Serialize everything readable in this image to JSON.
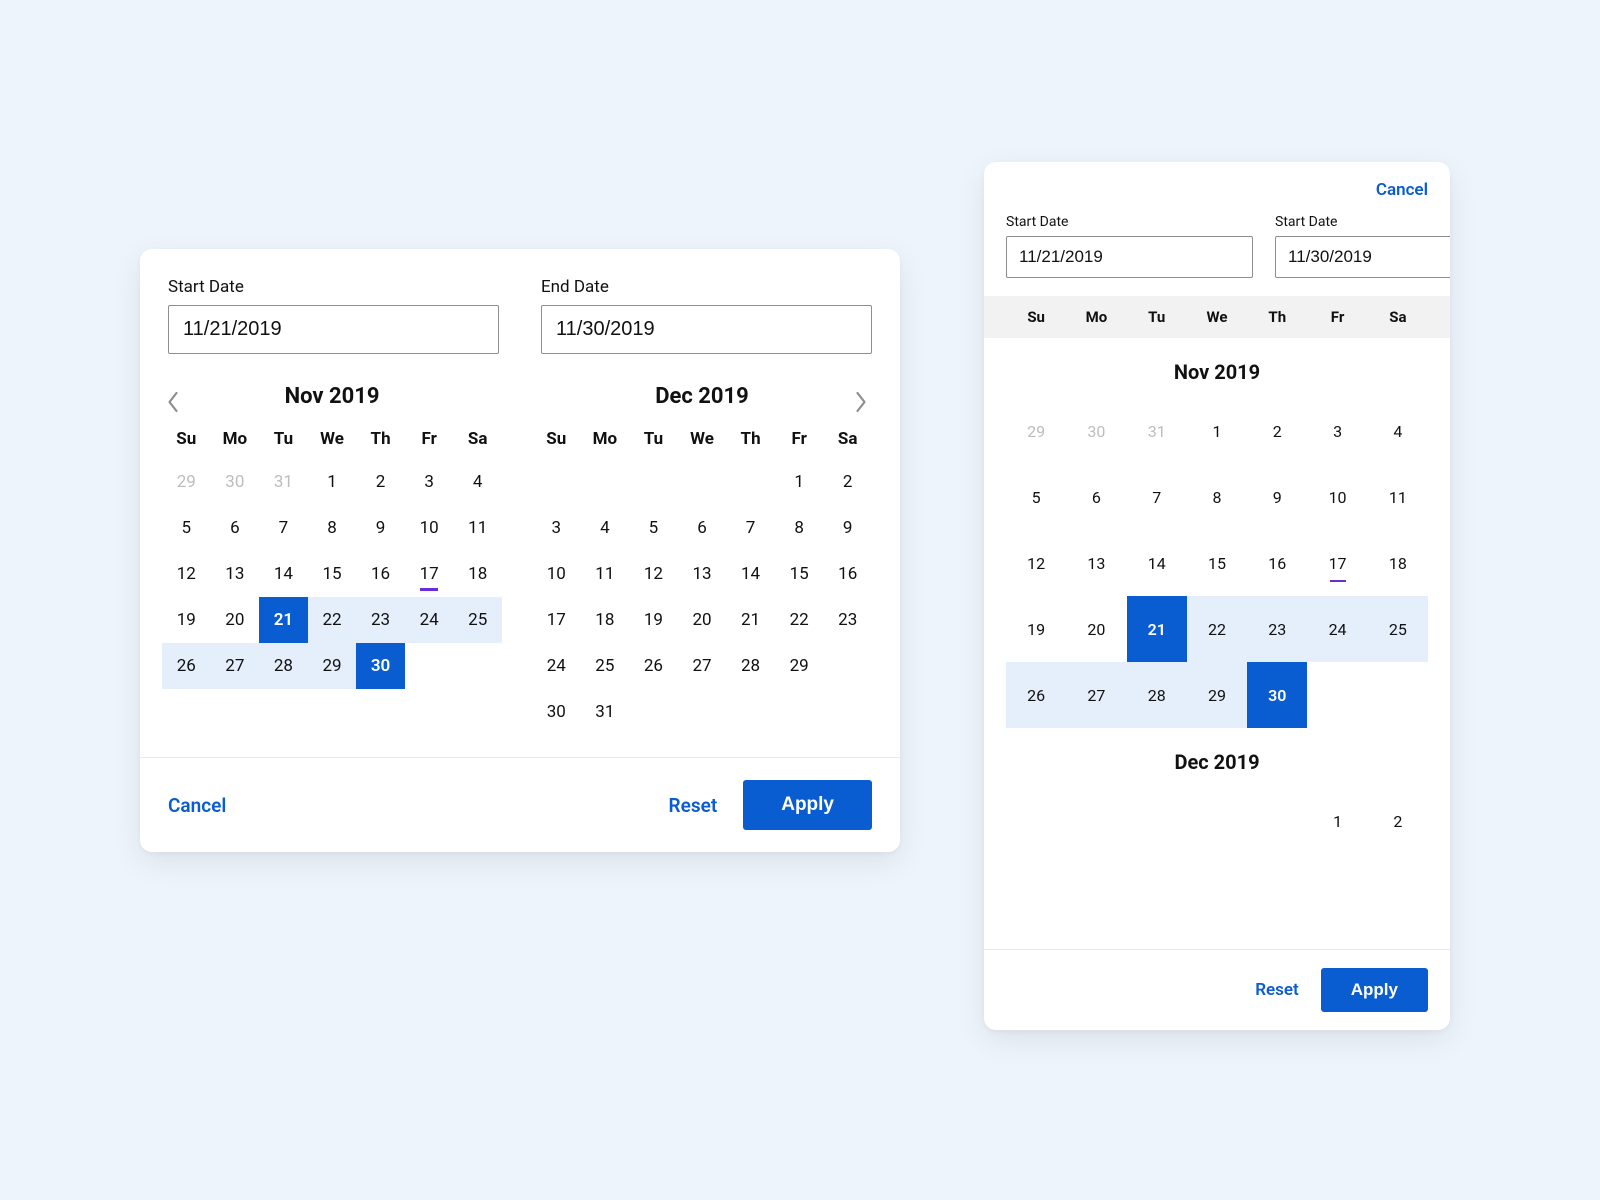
{
  "labels": {
    "startDate": "Start Date",
    "endDate": "End Date",
    "cancel": "Cancel",
    "reset": "Reset",
    "apply": "Apply"
  },
  "values": {
    "startDate": "11/21/2019",
    "endDate": "11/30/2019"
  },
  "dow": [
    "Su",
    "Mo",
    "Tu",
    "We",
    "Th",
    "Fr",
    "Sa"
  ],
  "desktop": {
    "months": [
      {
        "title": "Nov 2019",
        "weeks": [
          [
            {
              "n": "29",
              "muted": true
            },
            {
              "n": "30",
              "muted": true
            },
            {
              "n": "31",
              "muted": true
            },
            {
              "n": "1"
            },
            {
              "n": "2"
            },
            {
              "n": "3"
            },
            {
              "n": "4"
            }
          ],
          [
            {
              "n": "5"
            },
            {
              "n": "6"
            },
            {
              "n": "7"
            },
            {
              "n": "8"
            },
            {
              "n": "9"
            },
            {
              "n": "10"
            },
            {
              "n": "11"
            }
          ],
          [
            {
              "n": "12"
            },
            {
              "n": "13"
            },
            {
              "n": "14"
            },
            {
              "n": "15"
            },
            {
              "n": "16"
            },
            {
              "n": "17",
              "today": true
            },
            {
              "n": "18"
            }
          ],
          [
            {
              "n": "19"
            },
            {
              "n": "20"
            },
            {
              "n": "21",
              "sel": true
            },
            {
              "n": "22",
              "range": true
            },
            {
              "n": "23",
              "range": true
            },
            {
              "n": "24",
              "range": true
            },
            {
              "n": "25",
              "range": true
            }
          ],
          [
            {
              "n": "26",
              "range": true
            },
            {
              "n": "27",
              "range": true
            },
            {
              "n": "28",
              "range": true
            },
            {
              "n": "29",
              "range": true
            },
            {
              "n": "30",
              "sel": true
            },
            {
              "n": ""
            },
            {
              "n": ""
            }
          ]
        ]
      },
      {
        "title": "Dec 2019",
        "weeks": [
          [
            {
              "n": ""
            },
            {
              "n": ""
            },
            {
              "n": ""
            },
            {
              "n": ""
            },
            {
              "n": ""
            },
            {
              "n": "1"
            },
            {
              "n": "2"
            }
          ],
          [
            {
              "n": "3"
            },
            {
              "n": "4"
            },
            {
              "n": "5"
            },
            {
              "n": "6"
            },
            {
              "n": "7"
            },
            {
              "n": "8"
            },
            {
              "n": "9"
            }
          ],
          [
            {
              "n": "10"
            },
            {
              "n": "11"
            },
            {
              "n": "12"
            },
            {
              "n": "13"
            },
            {
              "n": "14"
            },
            {
              "n": "15"
            },
            {
              "n": "16"
            }
          ],
          [
            {
              "n": "17"
            },
            {
              "n": "18"
            },
            {
              "n": "19"
            },
            {
              "n": "20"
            },
            {
              "n": "21"
            },
            {
              "n": "22"
            },
            {
              "n": "23"
            }
          ],
          [
            {
              "n": "24"
            },
            {
              "n": "25"
            },
            {
              "n": "26"
            },
            {
              "n": "27"
            },
            {
              "n": "28"
            },
            {
              "n": "29"
            },
            {
              "n": ""
            }
          ],
          [
            {
              "n": "30"
            },
            {
              "n": "31"
            },
            {
              "n": ""
            },
            {
              "n": ""
            },
            {
              "n": ""
            },
            {
              "n": ""
            },
            {
              "n": ""
            }
          ]
        ]
      }
    ]
  },
  "mobile": {
    "startLabel": "Start Date",
    "endLabel": "Start Date",
    "months": [
      {
        "title": "Nov 2019",
        "weeks": [
          [
            {
              "n": "29",
              "muted": true
            },
            {
              "n": "30",
              "muted": true
            },
            {
              "n": "31",
              "muted": true
            },
            {
              "n": "1"
            },
            {
              "n": "2"
            },
            {
              "n": "3"
            },
            {
              "n": "4"
            }
          ],
          [
            {
              "n": "5"
            },
            {
              "n": "6"
            },
            {
              "n": "7"
            },
            {
              "n": "8"
            },
            {
              "n": "9"
            },
            {
              "n": "10"
            },
            {
              "n": "11"
            }
          ],
          [
            {
              "n": "12"
            },
            {
              "n": "13"
            },
            {
              "n": "14"
            },
            {
              "n": "15"
            },
            {
              "n": "16"
            },
            {
              "n": "17",
              "today": true
            },
            {
              "n": "18"
            }
          ],
          [
            {
              "n": "19"
            },
            {
              "n": "20"
            },
            {
              "n": "21",
              "sel": true
            },
            {
              "n": "22",
              "range": true
            },
            {
              "n": "23",
              "range": true
            },
            {
              "n": "24",
              "range": true
            },
            {
              "n": "25",
              "range": true
            }
          ],
          [
            {
              "n": "26",
              "range": true
            },
            {
              "n": "27",
              "range": true
            },
            {
              "n": "28",
              "range": true
            },
            {
              "n": "29",
              "range": true
            },
            {
              "n": "30",
              "sel": true
            },
            {
              "n": ""
            },
            {
              "n": ""
            }
          ]
        ]
      },
      {
        "title": "Dec 2019",
        "weeks": [
          [
            {
              "n": ""
            },
            {
              "n": ""
            },
            {
              "n": ""
            },
            {
              "n": ""
            },
            {
              "n": ""
            },
            {
              "n": "1"
            },
            {
              "n": "2"
            }
          ]
        ]
      }
    ]
  }
}
